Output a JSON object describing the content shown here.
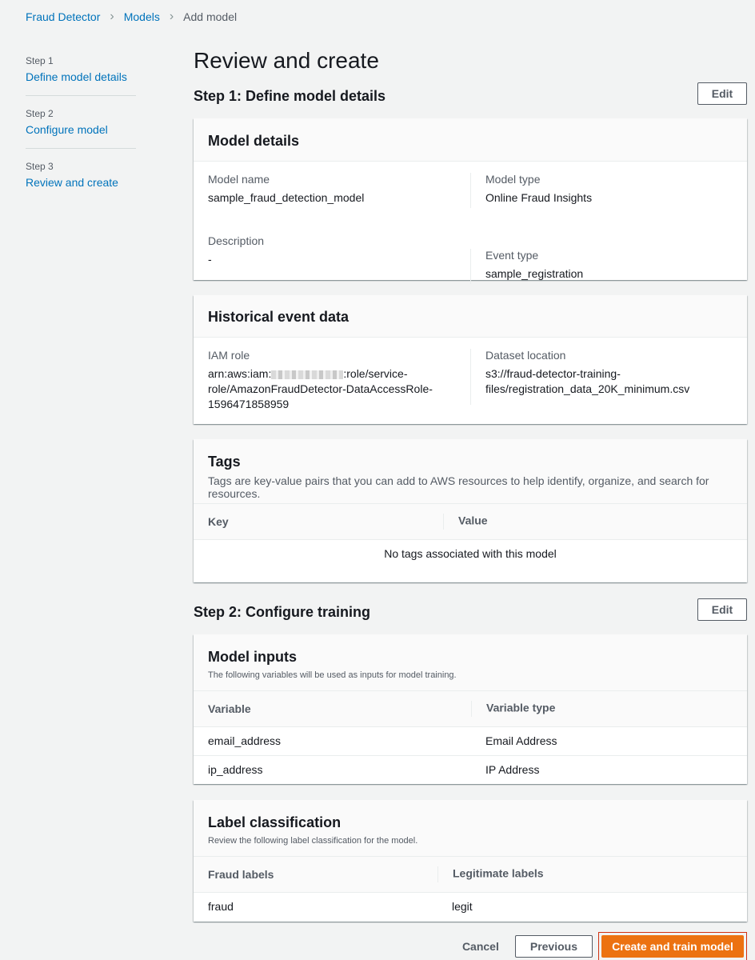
{
  "breadcrumb": [
    {
      "label": "Fraud Detector"
    },
    {
      "label": "Models"
    },
    {
      "label": "Add model"
    }
  ],
  "steps": [
    {
      "num": "Step 1",
      "label": "Define model details"
    },
    {
      "num": "Step 2",
      "label": "Configure model"
    },
    {
      "num": "Step 3",
      "label": "Review and create"
    }
  ],
  "page_title": "Review and create",
  "edit_label": "Edit",
  "step1": {
    "title": "Step 1: Define model details",
    "model_details": {
      "title": "Model details",
      "model_name_label": "Model name",
      "model_name": "sample_fraud_detection_model",
      "model_type_label": "Model type",
      "model_type": "Online Fraud Insights",
      "description_label": "Description",
      "description": "-",
      "event_type_label": "Event type",
      "event_type": "sample_registration"
    },
    "historical": {
      "title": "Historical event data",
      "iam_label": "IAM role",
      "iam_prefix": "arn:aws:iam:",
      "iam_line1_suffix": ":role/service-",
      "iam_line2": "role/AmazonFraudDetector-DataAccessRole-",
      "iam_line3": "1596471858959",
      "dataset_label": "Dataset location",
      "dataset_line1": "s3://fraud-detector-training-",
      "dataset_line2": "files/registration_data_20K_minimum.csv"
    },
    "tags": {
      "title": "Tags",
      "description": "Tags are key-value pairs that you can add to AWS resources to help identify, organize, and search for resources.",
      "col_key": "Key",
      "col_value": "Value",
      "empty": "No tags associated with this model"
    }
  },
  "step2": {
    "title": "Step 2: Configure training",
    "inputs": {
      "title": "Model inputs",
      "description": "The following variables will be used as inputs for model training.",
      "col_variable": "Variable",
      "col_type": "Variable type",
      "rows": [
        {
          "variable": "email_address",
          "type": "Email Address"
        },
        {
          "variable": "ip_address",
          "type": "IP Address"
        }
      ]
    },
    "labels": {
      "title": "Label classification",
      "description": "Review the following label classification for the model.",
      "col_fraud": "Fraud labels",
      "col_legit": "Legitimate labels",
      "fraud": "fraud",
      "legit": "legit"
    }
  },
  "actions": {
    "cancel": "Cancel",
    "previous": "Previous",
    "create": "Create and train model"
  }
}
